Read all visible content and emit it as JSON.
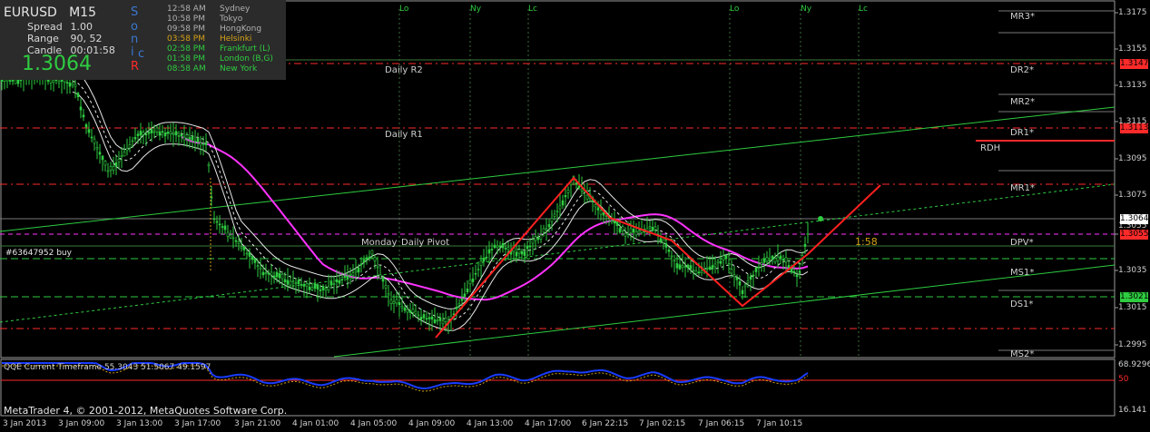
{
  "header": {
    "symbol": "EURUSD",
    "timeframe": "M15",
    "spread_label": "Spread",
    "spread_value": "1.00",
    "range_label": "Range",
    "range_value": "90, 52",
    "candle_label": "Candle",
    "candle_value": "00:01:58",
    "bid": "1.3064",
    "sonic_letters": [
      "S",
      "o",
      "n",
      "i",
      "c",
      "R"
    ]
  },
  "sessions": [
    {
      "time": "12:58 AM",
      "name": "Sydney",
      "color": "#b0b0b0"
    },
    {
      "time": "10:58 PM",
      "name": "Tokyo",
      "color": "#b0b0b0"
    },
    {
      "time": "09:58 PM",
      "name": "HongKong",
      "color": "#b0b0b0"
    },
    {
      "time": "03:58 PM",
      "name": "Helsinki",
      "color": "#d4a017"
    },
    {
      "time": "02:58 PM",
      "name": "Frankfurt (L)",
      "color": "#2ecc40"
    },
    {
      "time": "01:58 PM",
      "name": "London (B,G)",
      "color": "#2ecc40"
    },
    {
      "time": "08:58 AM",
      "name": "New York",
      "color": "#2ecc40"
    }
  ],
  "session_markers": [
    "Lo",
    "Ny",
    "Lc",
    "Lo",
    "Ny",
    "Lc"
  ],
  "levels": {
    "mr3": "MR3*",
    "dr2": "DR2*",
    "mr2": "MR2*",
    "dr1": "DR1*",
    "rdh": "RDH",
    "mr1": "MR1*",
    "dpv": "DPV*",
    "ms1": "MS1*",
    "ds1": "DS1*",
    "ms2": "MS2*",
    "daily_r2": "Daily R2",
    "daily_r1": "Daily R1",
    "monday": "Monday",
    "daily_pivot": "Daily Pivot",
    "timer": "1:58",
    "order": "#63647952 buy"
  },
  "price_axis": [
    "1.3175",
    "1.3155",
    "1.3135",
    "1.3115",
    "1.3095",
    "1.3075",
    "1.3055",
    "1.3035",
    "1.3015",
    "1.2995"
  ],
  "price_boxes": [
    {
      "text": "1.3147",
      "color": "#ff2a2a"
    },
    {
      "text": "1.3113",
      "color": "#ff2a2a"
    },
    {
      "text": "1.3064",
      "color": "#ffffff"
    },
    {
      "text": "1.3055",
      "color": "#ff2a2a"
    },
    {
      "text": "1.3021",
      "color": "#2ecc40"
    }
  ],
  "time_axis": [
    "3 Jan 2013",
    "3 Jan 09:00",
    "3 Jan 13:00",
    "3 Jan 17:00",
    "3 Jan 21:00",
    "4 Jan 01:00",
    "4 Jan 05:00",
    "4 Jan 09:00",
    "4 Jan 13:00",
    "4 Jan 17:00",
    "6 Jan 22:15",
    "7 Jan 02:15",
    "7 Jan 06:15",
    "7 Jan 10:15"
  ],
  "indicator": {
    "title": "QQE Current Timeframe 55.3043 51.5067 49.1597",
    "axis_top": "68.9296",
    "axis_mid": "50",
    "axis_bottom": "16.141"
  },
  "footer": {
    "copyright": "MetaTrader 4, © 2001-2012, MetaQuotes Software Corp."
  },
  "colors": {
    "bull": "#2ecc40",
    "bear": "#2ecc40",
    "ma": "#ff33ff",
    "pattern": "#ff2020",
    "qqe": "#1a3cff",
    "level_red": "#ff2a2a"
  }
}
